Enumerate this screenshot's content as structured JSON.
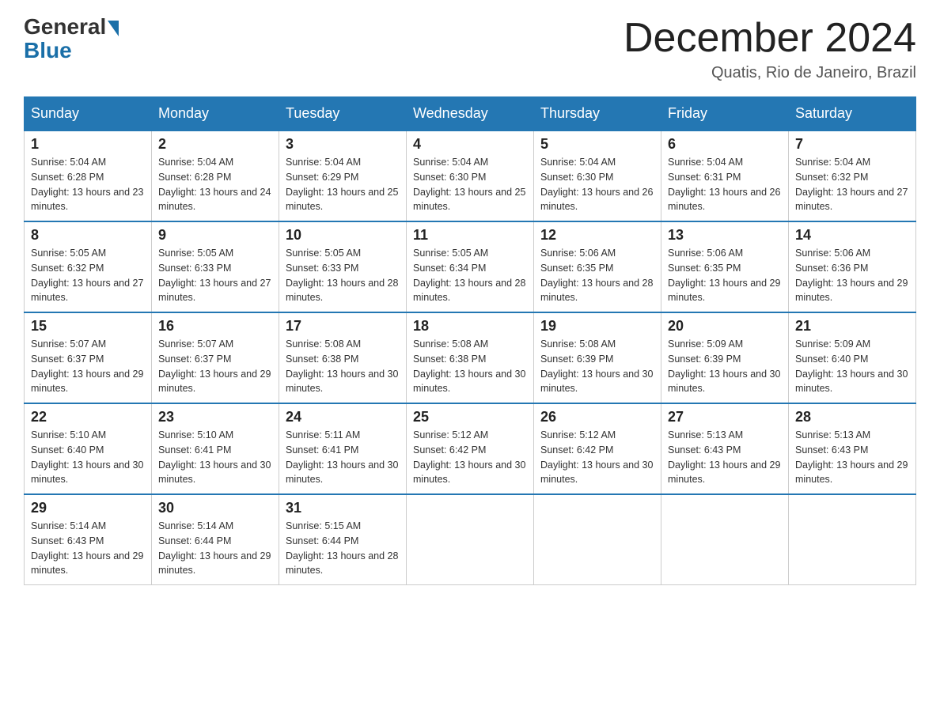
{
  "header": {
    "logo_general": "General",
    "logo_blue": "Blue",
    "title": "December 2024",
    "location": "Quatis, Rio de Janeiro, Brazil"
  },
  "days_of_week": [
    "Sunday",
    "Monday",
    "Tuesday",
    "Wednesday",
    "Thursday",
    "Friday",
    "Saturday"
  ],
  "weeks": [
    [
      {
        "day": "1",
        "sunrise": "5:04 AM",
        "sunset": "6:28 PM",
        "daylight": "13 hours and 23 minutes."
      },
      {
        "day": "2",
        "sunrise": "5:04 AM",
        "sunset": "6:28 PM",
        "daylight": "13 hours and 24 minutes."
      },
      {
        "day": "3",
        "sunrise": "5:04 AM",
        "sunset": "6:29 PM",
        "daylight": "13 hours and 25 minutes."
      },
      {
        "day": "4",
        "sunrise": "5:04 AM",
        "sunset": "6:30 PM",
        "daylight": "13 hours and 25 minutes."
      },
      {
        "day": "5",
        "sunrise": "5:04 AM",
        "sunset": "6:30 PM",
        "daylight": "13 hours and 26 minutes."
      },
      {
        "day": "6",
        "sunrise": "5:04 AM",
        "sunset": "6:31 PM",
        "daylight": "13 hours and 26 minutes."
      },
      {
        "day": "7",
        "sunrise": "5:04 AM",
        "sunset": "6:32 PM",
        "daylight": "13 hours and 27 minutes."
      }
    ],
    [
      {
        "day": "8",
        "sunrise": "5:05 AM",
        "sunset": "6:32 PM",
        "daylight": "13 hours and 27 minutes."
      },
      {
        "day": "9",
        "sunrise": "5:05 AM",
        "sunset": "6:33 PM",
        "daylight": "13 hours and 27 minutes."
      },
      {
        "day": "10",
        "sunrise": "5:05 AM",
        "sunset": "6:33 PM",
        "daylight": "13 hours and 28 minutes."
      },
      {
        "day": "11",
        "sunrise": "5:05 AM",
        "sunset": "6:34 PM",
        "daylight": "13 hours and 28 minutes."
      },
      {
        "day": "12",
        "sunrise": "5:06 AM",
        "sunset": "6:35 PM",
        "daylight": "13 hours and 28 minutes."
      },
      {
        "day": "13",
        "sunrise": "5:06 AM",
        "sunset": "6:35 PM",
        "daylight": "13 hours and 29 minutes."
      },
      {
        "day": "14",
        "sunrise": "5:06 AM",
        "sunset": "6:36 PM",
        "daylight": "13 hours and 29 minutes."
      }
    ],
    [
      {
        "day": "15",
        "sunrise": "5:07 AM",
        "sunset": "6:37 PM",
        "daylight": "13 hours and 29 minutes."
      },
      {
        "day": "16",
        "sunrise": "5:07 AM",
        "sunset": "6:37 PM",
        "daylight": "13 hours and 29 minutes."
      },
      {
        "day": "17",
        "sunrise": "5:08 AM",
        "sunset": "6:38 PM",
        "daylight": "13 hours and 30 minutes."
      },
      {
        "day": "18",
        "sunrise": "5:08 AM",
        "sunset": "6:38 PM",
        "daylight": "13 hours and 30 minutes."
      },
      {
        "day": "19",
        "sunrise": "5:08 AM",
        "sunset": "6:39 PM",
        "daylight": "13 hours and 30 minutes."
      },
      {
        "day": "20",
        "sunrise": "5:09 AM",
        "sunset": "6:39 PM",
        "daylight": "13 hours and 30 minutes."
      },
      {
        "day": "21",
        "sunrise": "5:09 AM",
        "sunset": "6:40 PM",
        "daylight": "13 hours and 30 minutes."
      }
    ],
    [
      {
        "day": "22",
        "sunrise": "5:10 AM",
        "sunset": "6:40 PM",
        "daylight": "13 hours and 30 minutes."
      },
      {
        "day": "23",
        "sunrise": "5:10 AM",
        "sunset": "6:41 PM",
        "daylight": "13 hours and 30 minutes."
      },
      {
        "day": "24",
        "sunrise": "5:11 AM",
        "sunset": "6:41 PM",
        "daylight": "13 hours and 30 minutes."
      },
      {
        "day": "25",
        "sunrise": "5:12 AM",
        "sunset": "6:42 PM",
        "daylight": "13 hours and 30 minutes."
      },
      {
        "day": "26",
        "sunrise": "5:12 AM",
        "sunset": "6:42 PM",
        "daylight": "13 hours and 30 minutes."
      },
      {
        "day": "27",
        "sunrise": "5:13 AM",
        "sunset": "6:43 PM",
        "daylight": "13 hours and 29 minutes."
      },
      {
        "day": "28",
        "sunrise": "5:13 AM",
        "sunset": "6:43 PM",
        "daylight": "13 hours and 29 minutes."
      }
    ],
    [
      {
        "day": "29",
        "sunrise": "5:14 AM",
        "sunset": "6:43 PM",
        "daylight": "13 hours and 29 minutes."
      },
      {
        "day": "30",
        "sunrise": "5:14 AM",
        "sunset": "6:44 PM",
        "daylight": "13 hours and 29 minutes."
      },
      {
        "day": "31",
        "sunrise": "5:15 AM",
        "sunset": "6:44 PM",
        "daylight": "13 hours and 28 minutes."
      },
      null,
      null,
      null,
      null
    ]
  ]
}
